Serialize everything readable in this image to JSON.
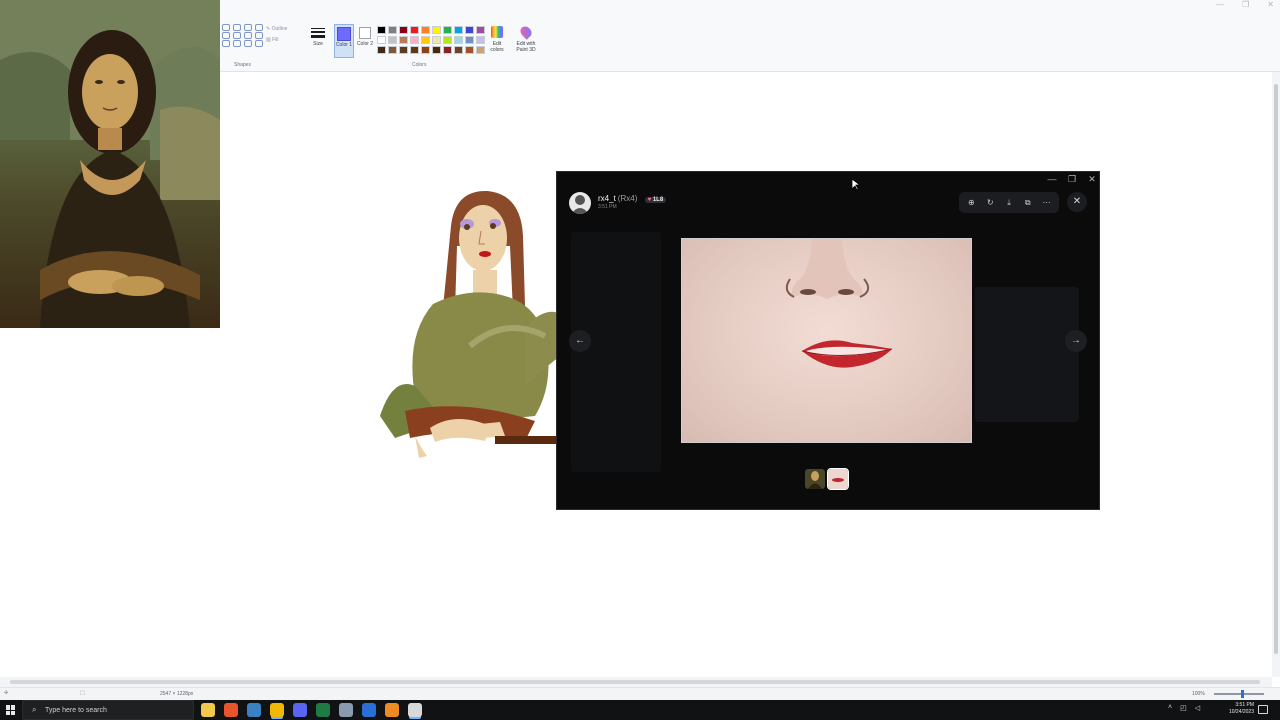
{
  "ribbon": {
    "shapes_label": "Shapes",
    "outline_label": "Outline",
    "fill_label": "Fill",
    "size_label": "Size",
    "color1_label": "Color 1",
    "color2_label": "Color 2",
    "colors_label": "Colors",
    "edit_colors_label": "Edit colors",
    "paint3d_label": "Edit with Paint 3D",
    "color1_value": "#6b6bff",
    "color2_value": "#ffffff",
    "palette": [
      "#000000",
      "#7f7f7f",
      "#880015",
      "#ed1c24",
      "#ff7f27",
      "#fff200",
      "#22b14c",
      "#00a2e8",
      "#3f48cc",
      "#a349a4",
      "#ffffff",
      "#c3c3c3",
      "#b97a57",
      "#ffaec9",
      "#ffc90e",
      "#efe4b0",
      "#b5e61d",
      "#99d9ea",
      "#7092be",
      "#c8bfe7",
      "#3d2a1a",
      "#7a5a3a",
      "#5c3d20",
      "#603913",
      "#8b4513",
      "#4a2a0a",
      "#8b2323",
      "#6b4423",
      "#a0522d",
      "#caa472"
    ]
  },
  "window_controls": [
    "—",
    "❐",
    "✕"
  ],
  "viewer": {
    "username": "rx4_t",
    "nickname": "(Rx4)",
    "badge_heart": "♥",
    "badge_text": "1L8",
    "timestamp": "3:51 PM",
    "toolbar_icons": [
      "zoom-icon",
      "rotate-icon",
      "download-icon",
      "open-external-icon",
      "more-icon"
    ],
    "close_glyph": "✕",
    "prev_glyph": "←",
    "next_glyph": "→",
    "minimize_glyph": "—",
    "maximize_glyph": "❐",
    "window_close_glyph": "✕"
  },
  "statusbar": {
    "dimensions": "2547 × 1228px",
    "zoom": "100%"
  },
  "taskbar": {
    "search_placeholder": "Type here to search",
    "time": "3:51 PM",
    "date": "10/24/2023",
    "apps": [
      {
        "name": "file-explorer-icon",
        "color": "#f2c94c"
      },
      {
        "name": "brave-icon",
        "color": "#e8542b"
      },
      {
        "name": "calendar-icon",
        "color": "#3b82c4"
      },
      {
        "name": "chrome-icon",
        "color": "#f2b705"
      },
      {
        "name": "discord-icon",
        "color": "#5865f2"
      },
      {
        "name": "excel-icon",
        "color": "#1f7a44"
      },
      {
        "name": "steam-icon",
        "color": "#8a9bb0"
      },
      {
        "name": "store-icon",
        "color": "#2a6fd6"
      },
      {
        "name": "ableton-icon",
        "color": "#f08a24"
      },
      {
        "name": "paint-icon",
        "color": "#d9d9d9"
      }
    ]
  }
}
